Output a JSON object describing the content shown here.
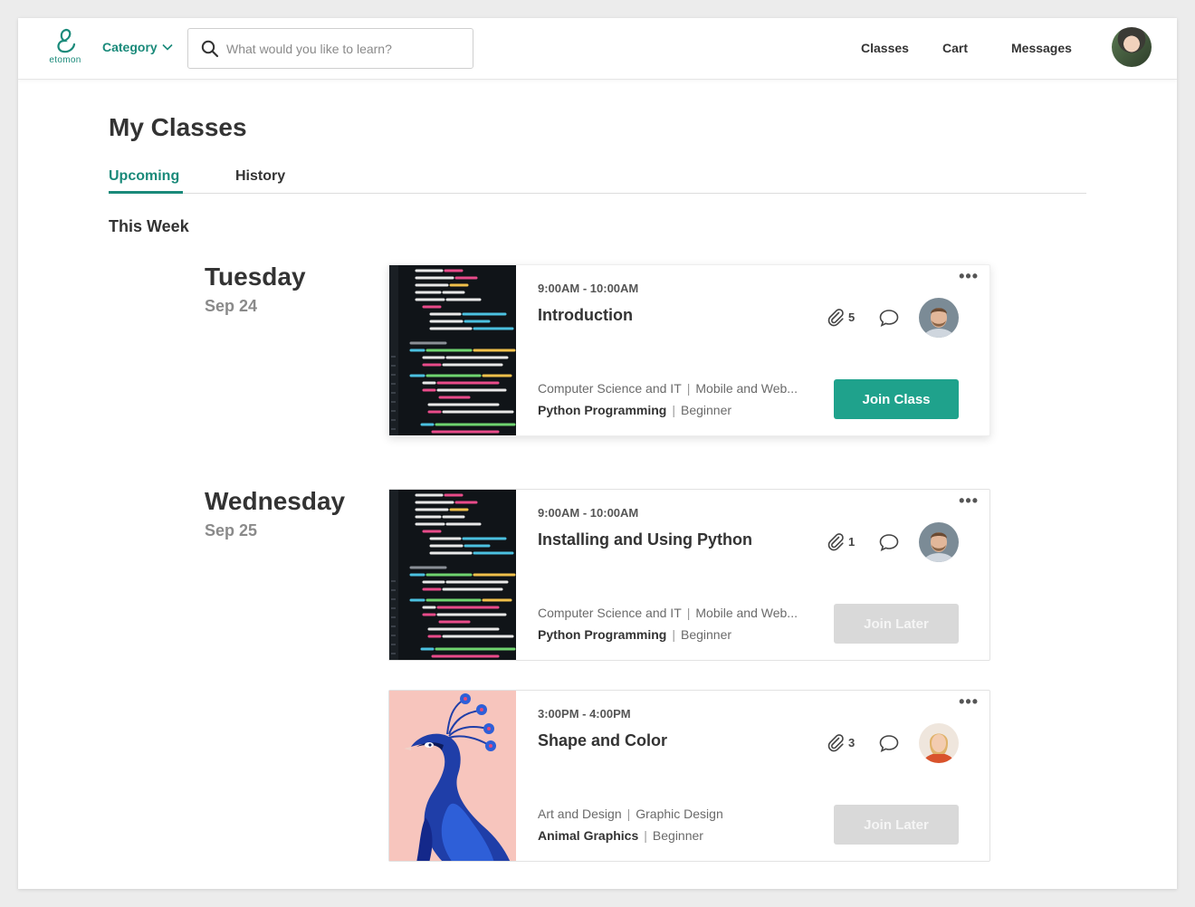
{
  "header": {
    "logo_text": "etomon",
    "category_label": "Category",
    "search_placeholder": "What would you like to learn?",
    "nav": {
      "classes": "Classes",
      "cart": "Cart",
      "messages": "Messages"
    }
  },
  "page": {
    "title": "My Classes",
    "tabs": {
      "upcoming": "Upcoming",
      "history": "History"
    },
    "section_title": "This Week"
  },
  "days": [
    {
      "name": "Tuesday",
      "date": "Sep 24"
    },
    {
      "name": "Wednesday",
      "date": "Sep 25"
    }
  ],
  "cards": [
    {
      "time": "9:00AM - 10:00AM",
      "title": "Introduction",
      "attachments": "5",
      "category": "Computer Science and IT",
      "subcategory": "Mobile and Web...",
      "course": "Python Programming",
      "level": "Beginner",
      "button": "Join Class",
      "thumb": "code-image",
      "more": "•••"
    },
    {
      "time": "9:00AM - 10:00AM",
      "title": "Installing and Using Python",
      "attachments": "1",
      "category": "Computer Science and IT",
      "subcategory": "Mobile and Web...",
      "course": "Python Programming",
      "level": "Beginner",
      "button": "Join Later",
      "thumb": "code-image",
      "more": "•••"
    },
    {
      "time": "3:00PM - 4:00PM",
      "title": "Shape and Color",
      "attachments": "3",
      "category": "Art and Design",
      "subcategory": "Graphic Design",
      "course": "Animal Graphics",
      "level": "Beginner",
      "button": "Join Later",
      "thumb": "peacock-image",
      "more": "•••"
    }
  ],
  "colors": {
    "accent": "#1a8a7a",
    "button_primary": "#1fa28c",
    "button_disabled": "#d9d9d9"
  }
}
